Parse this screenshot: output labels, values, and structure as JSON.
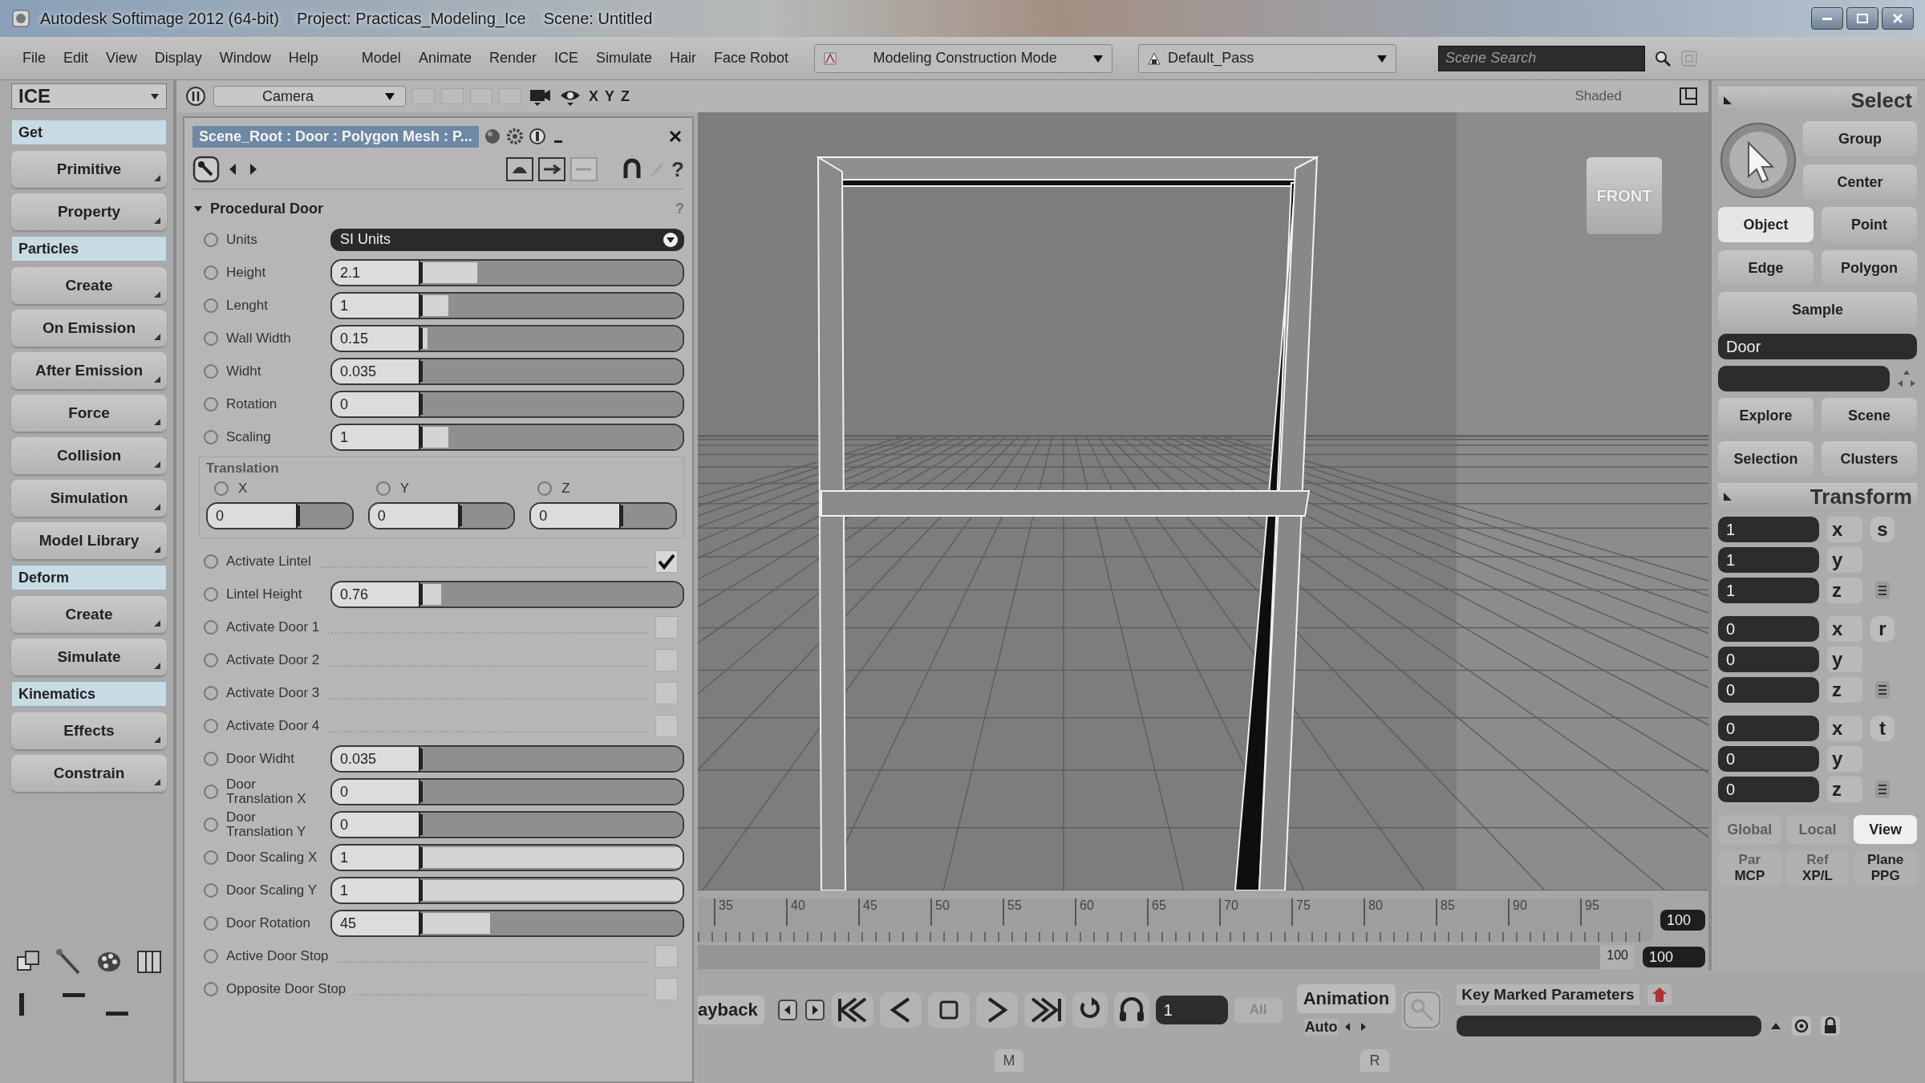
{
  "window": {
    "app_title": "Autodesk Softimage 2012 (64-bit)",
    "project": "Project: Practicas_Modeling_Ice",
    "scene": "Scene: Untitled"
  },
  "menu": {
    "items": [
      "File",
      "Edit",
      "View",
      "Display",
      "Window",
      "Help"
    ],
    "modules": [
      "Model",
      "Animate",
      "Render",
      "ICE",
      "Simulate",
      "Hair",
      "Face Robot"
    ],
    "mode": "Modeling Construction Mode",
    "pass": "Default_Pass",
    "search": {
      "placeholder": "Scene Search"
    }
  },
  "toolbar": {
    "layout": "ICE",
    "camera": "Camera",
    "axes": [
      "X",
      "Y",
      "Z"
    ],
    "display_mode": "Shaded"
  },
  "sidebar": {
    "items": [
      {
        "kind": "header",
        "label": "Get"
      },
      {
        "kind": "button",
        "label": "Primitive"
      },
      {
        "kind": "button",
        "label": "Property"
      },
      {
        "kind": "header",
        "label": "Particles"
      },
      {
        "kind": "button",
        "label": "Create"
      },
      {
        "kind": "button",
        "label": "On Emission"
      },
      {
        "kind": "button",
        "label": "After Emission"
      },
      {
        "kind": "button",
        "label": "Force"
      },
      {
        "kind": "button",
        "label": "Collision"
      },
      {
        "kind": "button",
        "label": "Simulation"
      },
      {
        "kind": "button",
        "label": "Model Library"
      },
      {
        "kind": "header",
        "label": "Deform"
      },
      {
        "kind": "button",
        "label": "Create"
      },
      {
        "kind": "button",
        "label": "Simulate"
      },
      {
        "kind": "header",
        "label": "Kinematics"
      },
      {
        "kind": "button",
        "label": "Effects"
      },
      {
        "kind": "button",
        "label": "Constrain"
      }
    ]
  },
  "ppg": {
    "title": "Scene_Root : Door : Polygon Mesh : P...",
    "help": "?",
    "section": "Procedural Door",
    "section_help": "?",
    "params": [
      {
        "kind": "dropdown",
        "label": "Units",
        "value": "SI Units"
      },
      {
        "kind": "slider",
        "label": "Height",
        "value": "2.1",
        "level": 0.21
      },
      {
        "kind": "slider",
        "label": "Lenght",
        "value": "1",
        "level": 0.1
      },
      {
        "kind": "slider",
        "label": "Wall Width",
        "value": "0.15",
        "level": 0.02
      },
      {
        "kind": "slider",
        "label": "Widht",
        "value": "0.035",
        "level": 0
      },
      {
        "kind": "slider",
        "label": "Rotation",
        "value": "0",
        "level": 0
      },
      {
        "kind": "slider",
        "label": "Scaling",
        "value": "1",
        "level": 0.1
      },
      {
        "kind": "vector",
        "label": "Translation",
        "axes": [
          {
            "label": "X",
            "value": "0",
            "level": 0
          },
          {
            "label": "Y",
            "value": "0",
            "level": 0
          },
          {
            "label": "Z",
            "value": "0",
            "level": 0
          }
        ]
      },
      {
        "kind": "check",
        "label": "Activate Lintel",
        "checked": true
      },
      {
        "kind": "slider",
        "label": "Lintel Height",
        "value": "0.76",
        "level": 0.07
      },
      {
        "kind": "check",
        "label": "Activate Door 1",
        "checked": false
      },
      {
        "kind": "check",
        "label": "Activate Door 2",
        "checked": false
      },
      {
        "kind": "check",
        "label": "Activate Door 3",
        "checked": false
      },
      {
        "kind": "check",
        "label": "Activate Door 4",
        "checked": false
      },
      {
        "kind": "slider",
        "label": "Door Widht",
        "value": "0.035",
        "level": 0
      },
      {
        "kind": "slider",
        "label": "Door Translation X",
        "value": "0",
        "level": 0
      },
      {
        "kind": "slider",
        "label": "Door Translation Y",
        "value": "0",
        "level": 0
      },
      {
        "kind": "slider",
        "label": "Door Scaling X",
        "value": "1",
        "level": 1
      },
      {
        "kind": "slider",
        "label": "Door Scaling Y",
        "value": "1",
        "level": 1
      },
      {
        "kind": "slider",
        "label": "Door Rotation",
        "value": "45",
        "level": 0.26
      },
      {
        "kind": "check",
        "label": "Active Door Stop",
        "checked": false
      },
      {
        "kind": "check",
        "label": "Opposite Door Stop",
        "checked": false
      }
    ]
  },
  "viewport": {
    "cube_label": "FRONT"
  },
  "timeline": {
    "ticks": [
      "35",
      "40",
      "45",
      "50",
      "55",
      "60",
      "65",
      "70",
      "75",
      "80",
      "85",
      "90",
      "95"
    ],
    "end_frame": "100",
    "range_label": "100",
    "range_end": "100"
  },
  "playback": {
    "label": "ayback",
    "frame": "1",
    "all": "All",
    "animation": "Animation",
    "auto": "Auto",
    "key_params": "Key Marked Parameters",
    "markers": [
      "M",
      "R"
    ]
  },
  "select_panel": {
    "title": "Select",
    "tools": [
      "Group",
      "Center"
    ],
    "filters": [
      {
        "label": "Object",
        "selected": true
      },
      {
        "label": "Point",
        "selected": false
      },
      {
        "label": "Edge",
        "selected": false
      },
      {
        "label": "Polygon",
        "selected": false
      }
    ],
    "sample": "Sample",
    "object_name": "Door",
    "links": [
      "Explore",
      "Scene",
      "Selection",
      "Clusters"
    ]
  },
  "transform": {
    "title": "Transform",
    "groups": [
      {
        "mode": "s",
        "rows": [
          {
            "axis": "x",
            "value": "1"
          },
          {
            "axis": "y",
            "value": "1"
          },
          {
            "axis": "z",
            "value": "1"
          }
        ]
      },
      {
        "mode": "r",
        "rows": [
          {
            "axis": "x",
            "value": "0"
          },
          {
            "axis": "y",
            "value": "0"
          },
          {
            "axis": "z",
            "value": "0"
          }
        ]
      },
      {
        "mode": "t",
        "rows": [
          {
            "axis": "x",
            "value": "0"
          },
          {
            "axis": "y",
            "value": "0"
          },
          {
            "axis": "z",
            "value": "0"
          }
        ]
      }
    ],
    "spaces": [
      {
        "label": "Global",
        "selected": false
      },
      {
        "label": "Local",
        "selected": false
      },
      {
        "label": "View",
        "selected": true
      }
    ],
    "references": [
      {
        "top": "Par",
        "bottom": "MCP",
        "disabled": true
      },
      {
        "top": "Ref",
        "bottom": "XP/L",
        "disabled": true
      },
      {
        "top": "Plane",
        "bottom": "PPG",
        "disabled": false
      }
    ]
  }
}
